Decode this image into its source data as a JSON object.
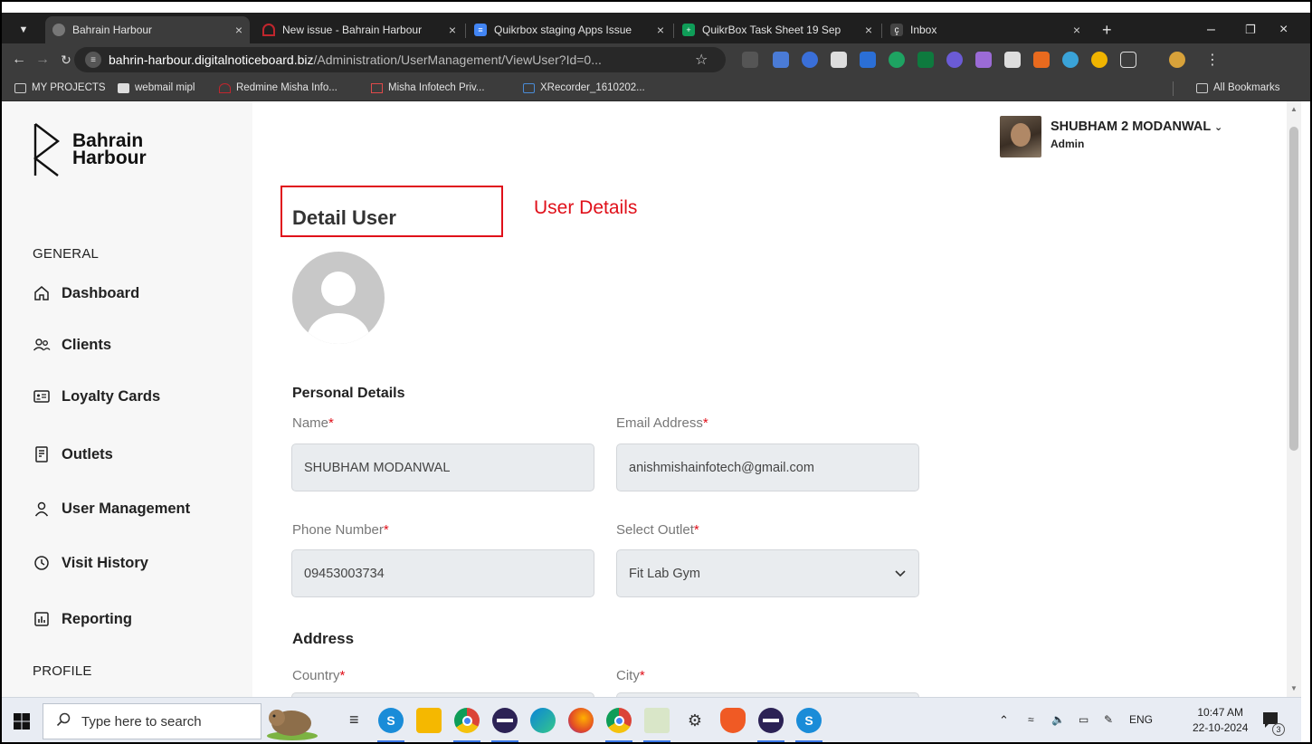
{
  "browser": {
    "tabs": [
      {
        "title": "Bahrain Harbour",
        "active": true
      },
      {
        "title": "New issue - Bahrain Harbour"
      },
      {
        "title": "Quikrbox staging Apps Issue"
      },
      {
        "title": "QuikrBox Task Sheet 19 Sep"
      },
      {
        "title": "Inbox"
      }
    ],
    "url_host": "bahrin-harbour.digitalnoticeboard.biz",
    "url_path": "/Administration/UserManagement/ViewUser?Id=0...",
    "bookmarks": [
      "MY PROJECTS",
      "webmail mipl",
      "Redmine Misha Info...",
      "Misha Infotech Priv...",
      "XRecorder_1610202..."
    ],
    "all_bookmarks": "All Bookmarks"
  },
  "sidebar": {
    "logo_line1": "Bahrain",
    "logo_line2": "Harbour",
    "section_general": "GENERAL",
    "items": [
      {
        "label": "Dashboard",
        "icon": "home-icon"
      },
      {
        "label": "Clients",
        "icon": "users-icon"
      },
      {
        "label": "Loyalty Cards",
        "icon": "card-icon"
      },
      {
        "label": "Outlets",
        "icon": "document-icon"
      },
      {
        "label": "User Management",
        "icon": "user-icon"
      },
      {
        "label": "Visit History",
        "icon": "clock-icon"
      },
      {
        "label": "Reporting",
        "icon": "chart-icon"
      }
    ],
    "section_profile": "PROFILE"
  },
  "header": {
    "user_name": "SHUBHAM 2 MODANWAL",
    "user_role": "Admin"
  },
  "main": {
    "page_title": "Detail User",
    "annotation": "User Details",
    "personal_details_title": "Personal Details",
    "fields": {
      "name_label": "Name",
      "name_value": "SHUBHAM MODANWAL",
      "email_label": "Email Address",
      "email_value": "anishmishainfotech@gmail.com",
      "phone_label": "Phone Number",
      "phone_value": "09453003734",
      "outlet_label": "Select Outlet",
      "outlet_value": "Fit Lab Gym"
    },
    "address_title": "Address",
    "country_label": "Country",
    "city_label": "City",
    "required_mark": "*"
  },
  "taskbar": {
    "search_placeholder": "Type here to search",
    "lang": "ENG",
    "time": "10:47 AM",
    "date": "22-10-2024",
    "notifications": "3"
  },
  "colors": {
    "accent_red": "#e0101a",
    "field_bg": "#e9ecef",
    "sidebar_bg": "#f7f7f7"
  }
}
